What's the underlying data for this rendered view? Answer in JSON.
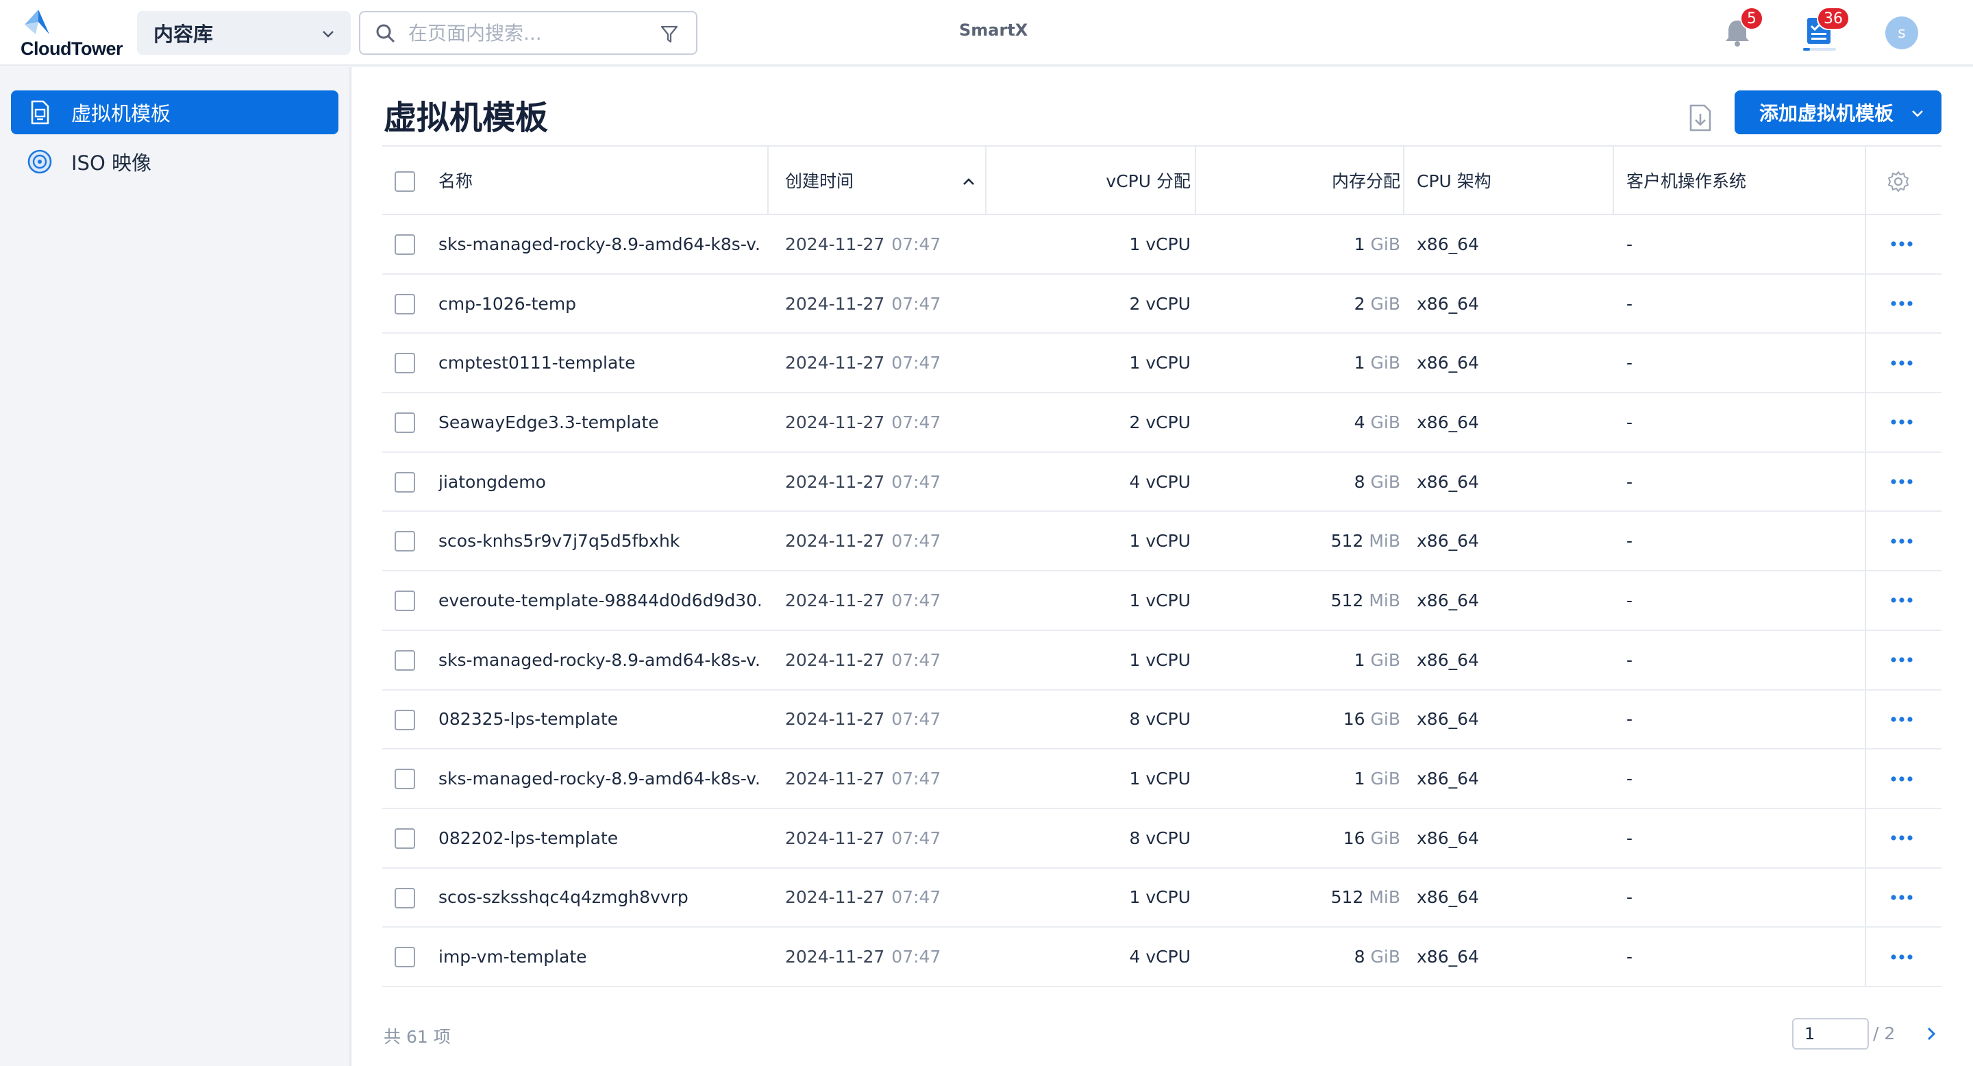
{
  "header": {
    "logo_text": "CloudTower",
    "library_select": "内容库",
    "search_placeholder": "在页面内搜索...",
    "brand": "SmartX",
    "notifications_count": "5",
    "tasks_count": "36",
    "avatar_initial": "s"
  },
  "sidebar": {
    "items": [
      {
        "label": "虚拟机模板",
        "active": true,
        "icon": "vm-template-icon"
      },
      {
        "label": "ISO 映像",
        "active": false,
        "icon": "disc-icon"
      }
    ]
  },
  "main": {
    "title": "虚拟机模板",
    "add_button": "添加虚拟机模板",
    "columns": {
      "name": "名称",
      "created": "创建时间",
      "vcpu": "vCPU 分配",
      "memory": "内存分配",
      "arch": "CPU 架构",
      "os": "客户机操作系统"
    },
    "rows": [
      {
        "name": "sks-managed-rocky-8.9-amd64-k8s-v...",
        "date": "2024-11-27",
        "time": "07:47",
        "vcpu": "1 vCPU",
        "mem": "1",
        "mem_unit": "GiB",
        "arch": "x86_64",
        "os": "-"
      },
      {
        "name": "cmp-1026-temp",
        "date": "2024-11-27",
        "time": "07:47",
        "vcpu": "2 vCPU",
        "mem": "2",
        "mem_unit": "GiB",
        "arch": "x86_64",
        "os": "-"
      },
      {
        "name": "cmptest0111-template",
        "date": "2024-11-27",
        "time": "07:47",
        "vcpu": "1 vCPU",
        "mem": "1",
        "mem_unit": "GiB",
        "arch": "x86_64",
        "os": "-"
      },
      {
        "name": "SeawayEdge3.3-template",
        "date": "2024-11-27",
        "time": "07:47",
        "vcpu": "2 vCPU",
        "mem": "4",
        "mem_unit": "GiB",
        "arch": "x86_64",
        "os": "-"
      },
      {
        "name": "jiatongdemo",
        "date": "2024-11-27",
        "time": "07:47",
        "vcpu": "4 vCPU",
        "mem": "8",
        "mem_unit": "GiB",
        "arch": "x86_64",
        "os": "-"
      },
      {
        "name": "scos-knhs5r9v7j7q5d5fbxhk",
        "date": "2024-11-27",
        "time": "07:47",
        "vcpu": "1 vCPU",
        "mem": "512",
        "mem_unit": "MiB",
        "arch": "x86_64",
        "os": "-"
      },
      {
        "name": "everoute-template-98844d0d6d9d30...",
        "date": "2024-11-27",
        "time": "07:47",
        "vcpu": "1 vCPU",
        "mem": "512",
        "mem_unit": "MiB",
        "arch": "x86_64",
        "os": "-"
      },
      {
        "name": "sks-managed-rocky-8.9-amd64-k8s-v...",
        "date": "2024-11-27",
        "time": "07:47",
        "vcpu": "1 vCPU",
        "mem": "1",
        "mem_unit": "GiB",
        "arch": "x86_64",
        "os": "-"
      },
      {
        "name": "082325-lps-template",
        "date": "2024-11-27",
        "time": "07:47",
        "vcpu": "8 vCPU",
        "mem": "16",
        "mem_unit": "GiB",
        "arch": "x86_64",
        "os": "-"
      },
      {
        "name": "sks-managed-rocky-8.9-amd64-k8s-v...",
        "date": "2024-11-27",
        "time": "07:47",
        "vcpu": "1 vCPU",
        "mem": "1",
        "mem_unit": "GiB",
        "arch": "x86_64",
        "os": "-"
      },
      {
        "name": "082202-lps-template",
        "date": "2024-11-27",
        "time": "07:47",
        "vcpu": "8 vCPU",
        "mem": "16",
        "mem_unit": "GiB",
        "arch": "x86_64",
        "os": "-"
      },
      {
        "name": "scos-szksshqc4q4zmgh8vvrp",
        "date": "2024-11-27",
        "time": "07:47",
        "vcpu": "1 vCPU",
        "mem": "512",
        "mem_unit": "MiB",
        "arch": "x86_64",
        "os": "-"
      },
      {
        "name": "imp-vm-template",
        "date": "2024-11-27",
        "time": "07:47",
        "vcpu": "4 vCPU",
        "mem": "8",
        "mem_unit": "GiB",
        "arch": "x86_64",
        "os": "-"
      }
    ],
    "total_text": "共 61 项",
    "pagination": {
      "current": "1",
      "total_pages": "/ 2"
    }
  },
  "colors": {
    "accent": "#0a6fe0",
    "badge": "#e0222c"
  }
}
